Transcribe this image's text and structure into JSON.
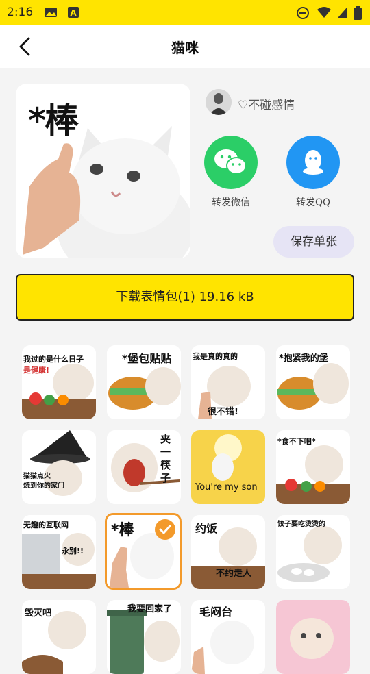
{
  "status": {
    "time": "2:16"
  },
  "header": {
    "title": "猫咪"
  },
  "preview": {
    "caption": "*棒"
  },
  "author": {
    "name": "♡不碰感情"
  },
  "share": {
    "wechat_label": "转发微信",
    "qq_label": "转发QQ"
  },
  "actions": {
    "save_single": "保存单张",
    "download": "下载表情包(1) 19.16 kB"
  },
  "colors": {
    "accent": "#ffe400",
    "wechat": "#2bce67",
    "qq": "#2196f3",
    "selected": "#f39a2b"
  },
  "stickers": [
    {
      "caption": "我过的是什么日子",
      "sub": "是健康!"
    },
    {
      "caption": "*堡包贴贴",
      "sub": ""
    },
    {
      "caption": "我是真的真的",
      "sub": "很不错!"
    },
    {
      "caption": "*抱紧我的堡",
      "sub": ""
    },
    {
      "caption": "猫猫点火",
      "sub": "烧到你的家门"
    },
    {
      "caption": "夹一筷子",
      "sub": ""
    },
    {
      "caption": "You're my son",
      "sub": ""
    },
    {
      "caption": "*食不下咽*",
      "sub": ""
    },
    {
      "caption": "无趣的互联网",
      "sub": "永别!!"
    },
    {
      "caption": "*棒",
      "sub": ""
    },
    {
      "caption": "约饭",
      "sub": "不约走人"
    },
    {
      "caption": "饺子要吃烫烫的",
      "sub": ""
    },
    {
      "caption": "毁灭吧",
      "sub": ""
    },
    {
      "caption": "我要回家了",
      "sub": ""
    },
    {
      "caption": "毛闷台",
      "sub": ""
    },
    {
      "caption": "",
      "sub": ""
    }
  ]
}
